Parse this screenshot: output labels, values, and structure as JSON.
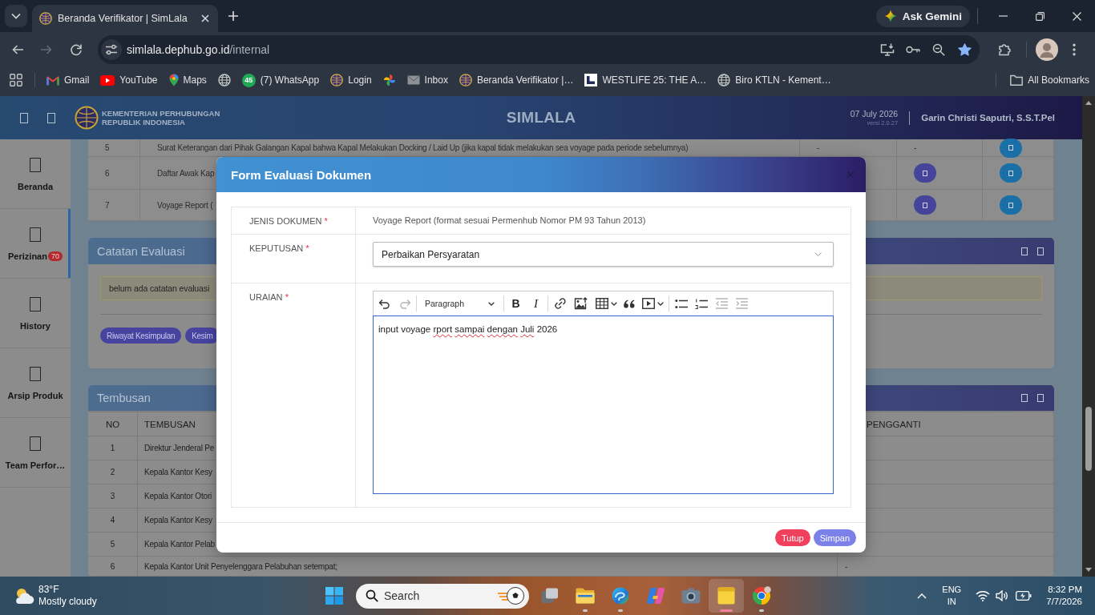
{
  "browser": {
    "tab": {
      "title": "Beranda Verifikator | SimLala",
      "selected": true
    },
    "gemini": "Ask Gemini",
    "forward_disabled": true,
    "url": {
      "host": "simlala.dephub.go.id",
      "path": "/internal"
    },
    "bookmarked": true,
    "bookmarks": [
      {
        "label": "Gmail"
      },
      {
        "label": "YouTube"
      },
      {
        "label": "Maps"
      },
      {
        "label": "(7) WhatsApp",
        "badge": "45"
      },
      {
        "label": "Login"
      },
      {
        "label": "Inbox"
      },
      {
        "label": "Beranda Verifikator |…"
      },
      {
        "label": "WESTLIFE 25: THE A…"
      },
      {
        "label": "Biro KTLN - Kement…"
      }
    ],
    "all_bookmarks": "All Bookmarks"
  },
  "app": {
    "header": {
      "org": [
        "KEMENTERIAN PERHUBUNGAN",
        "REPUBLIK INDONESIA"
      ],
      "title": "SIMLALA",
      "date": "07 July 2026",
      "version": "versi 2.0.27",
      "user": "Garin Christi Saputri, S.S.T.Pel"
    },
    "sidebar": [
      {
        "label": "Beranda",
        "selected": false
      },
      {
        "label": "Perizinan",
        "selected": true,
        "badge": "70"
      },
      {
        "label": "History",
        "selected": false
      },
      {
        "label": "Arsip Produk",
        "selected": false
      },
      {
        "label": "Team Perfor…",
        "selected": false
      }
    ],
    "documents": {
      "rows": [
        {
          "no": "5",
          "name": "Surat Keterangan dari Pihak Galangan Kapal bahwa Kapal Melakukan Docking / Laid Up (jika kapal tidak melakukan sea voyage pada periode sebelumnya)",
          "cells": [
            {
              "kind": "text",
              "text": "-"
            },
            {
              "kind": "text",
              "text": "-"
            },
            {
              "kind": "action"
            }
          ]
        },
        {
          "no": "6",
          "name": "Daftar Awak Kap",
          "cells": [
            {
              "kind": "empty"
            },
            {
              "kind": "action"
            },
            {
              "kind": "action"
            }
          ]
        },
        {
          "no": "7",
          "name": "Voyage Report (",
          "cells": [
            {
              "kind": "empty"
            },
            {
              "kind": "action"
            },
            {
              "kind": "action"
            }
          ]
        }
      ]
    },
    "notes": {
      "title": "Catatan Evaluasi",
      "message": "belum ada catatan evaluasi",
      "buttons": [
        "Riwayat Kesimpulan",
        "Kesim"
      ]
    },
    "copies": {
      "title": "Tembusan",
      "columns": [
        "NO",
        "TEMBUSAN",
        "PENGGANTI"
      ],
      "rows": [
        {
          "no": "1",
          "name": "Direktur Jenderal Pe"
        },
        {
          "no": "2",
          "name": "Kepala Kantor Kesy"
        },
        {
          "no": "3",
          "name": "Kepala Kantor Otori"
        },
        {
          "no": "4",
          "name": "Kepala Kantor Kesy"
        },
        {
          "no": "5",
          "name": "Kepala Kantor Pelab"
        },
        {
          "no": "6",
          "name": "Kepala Kantor Unit Penyelenggara Pelabuhan setempat;",
          "substitute": "-"
        }
      ]
    }
  },
  "modal": {
    "title": "Form Evaluasi Dokumen",
    "fields": [
      {
        "kind": "text",
        "label": "JENIS DOKUMEN",
        "required_mark": "*",
        "value": "Voyage Report (format sesuai Permenhub Nomor PM 93 Tahun 2013)"
      },
      {
        "kind": "select",
        "label": "KEPUTUSAN",
        "required_mark": "*",
        "value": "Perbaikan Persyaratan"
      },
      {
        "kind": "editor",
        "label": "URAIAN",
        "required_mark": "*",
        "focused": true,
        "toolbar": {
          "undo_disabled": false,
          "redo_disabled": true,
          "style": "Paragraph",
          "bold": "B",
          "italic": "I",
          "outdent_disabled": true,
          "indent_disabled": true
        },
        "words": [
          {
            "text": "input",
            "misspelled": false
          },
          {
            "text": "voyage",
            "misspelled": false
          },
          {
            "text": "rport",
            "misspelled": true
          },
          {
            "text": "sampai",
            "misspelled": true
          },
          {
            "text": "dengan",
            "misspelled": true
          },
          {
            "text": "Juli",
            "misspelled": true
          },
          {
            "text": "2026",
            "misspelled": false
          }
        ]
      }
    ],
    "buttons": [
      {
        "kind": "cancel",
        "label": "Tutup"
      },
      {
        "kind": "submit",
        "label": "Simpan"
      }
    ]
  },
  "taskbar": {
    "weather": {
      "temperature": "83°F",
      "condition": "Mostly cloudy"
    },
    "search": {
      "placeholder": "Search"
    },
    "apps": [
      {
        "running": false,
        "selected": false
      },
      {
        "running": true,
        "selected": false
      },
      {
        "running": true,
        "selected": false
      },
      {
        "running": false,
        "selected": false
      },
      {
        "running": false,
        "selected": false
      },
      {
        "running": true,
        "selected": true
      },
      {
        "running": true,
        "selected": false
      }
    ],
    "language": [
      "ENG",
      "IN"
    ],
    "clock": {
      "time": "8:32 PM",
      "date": "7/7/2026"
    }
  }
}
